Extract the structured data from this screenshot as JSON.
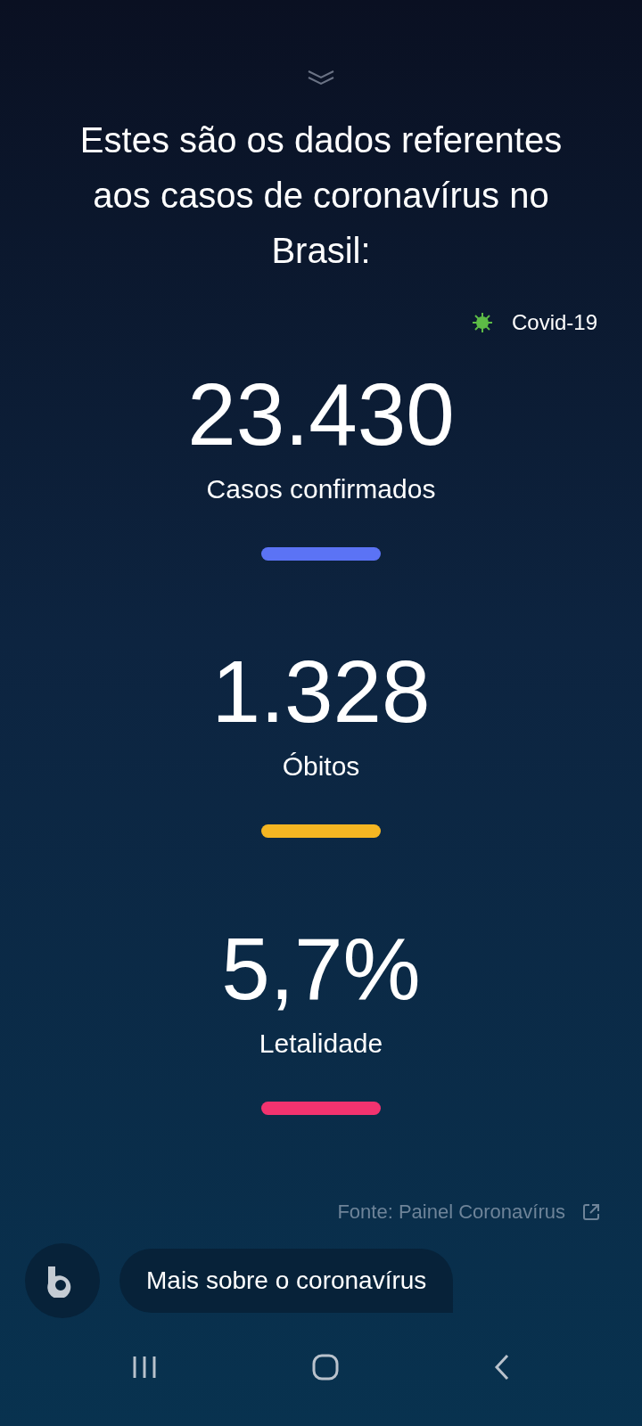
{
  "heading": "Estes são os dados referentes aos casos de coronavírus no Brasil:",
  "tag": {
    "label": "Covid-19"
  },
  "stats": [
    {
      "value": "23.430",
      "label": "Casos confirmados",
      "color": "#5b73f5"
    },
    {
      "value": "1.328",
      "label": "Óbitos",
      "color": "#f5b622"
    },
    {
      "value": "5,7%",
      "label": "Letalidade",
      "color": "#f2336f"
    }
  ],
  "source": {
    "label": "Fonte: Painel Coronavírus"
  },
  "suggestion": {
    "label": "Mais sobre o coronavírus"
  }
}
